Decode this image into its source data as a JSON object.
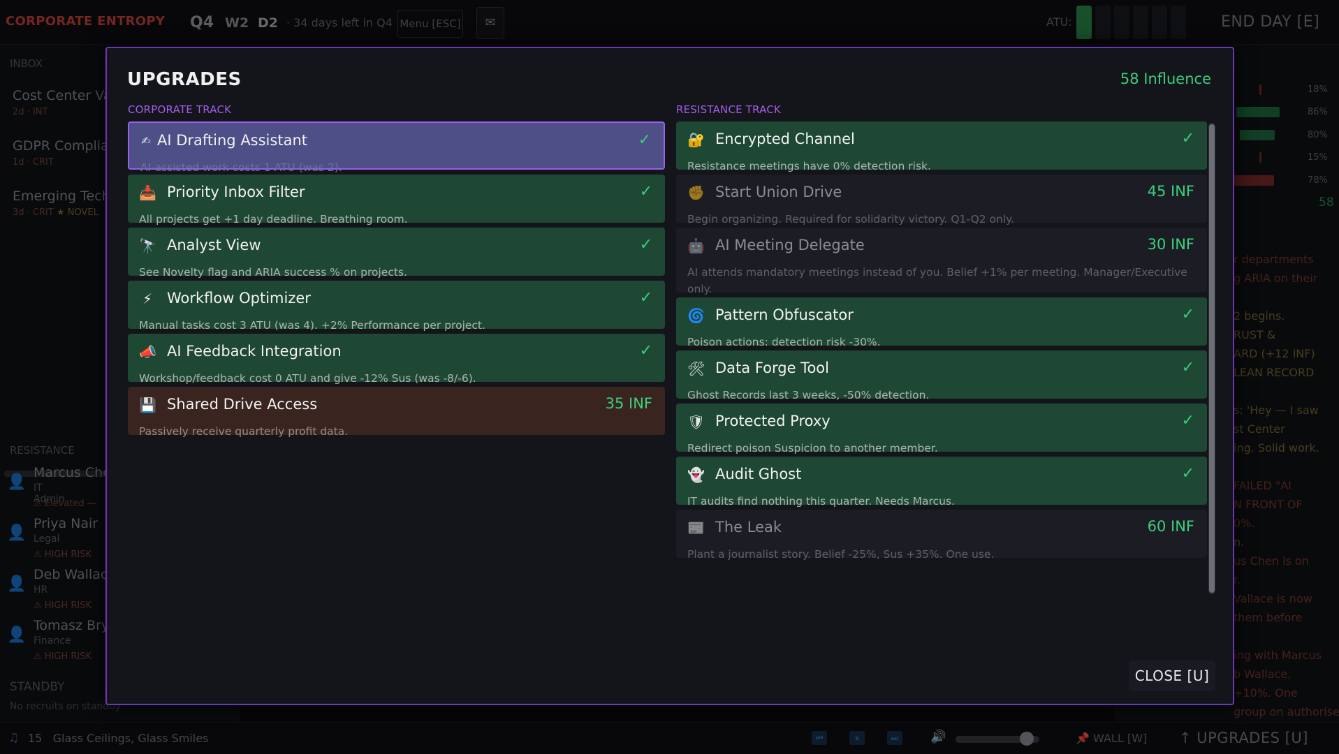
{
  "topbar": {
    "brand": "CORPORATE ENTROPY",
    "quarter": "Q4",
    "week": "W2",
    "day": "D2",
    "days_left": "· 34 days left in Q4",
    "menu_label": "Menu [ESC]",
    "atu_label": "ATU:",
    "atu_segments_filled": 1,
    "atu_segments_total": 6,
    "end_day_label": "END DAY [E]"
  },
  "left_panel": {
    "inbox_heading": "INBOX",
    "inbox_items": [
      {
        "title": "Cost Center Var",
        "meta": "2d · INT",
        "novel": ""
      },
      {
        "title": "GDPR Complian",
        "meta": "1d · CRIT",
        "novel": ""
      },
      {
        "title": "Emerging Tech",
        "meta": "3d · CRIT",
        "novel": "★ NOVEL"
      }
    ],
    "resistance_heading": "RESISTANCE",
    "members": [
      {
        "name": "Marcus Chen",
        "role": "IT Admin",
        "warning": "⚠ Elevated —"
      },
      {
        "name": "Priya Nair",
        "role": "Legal",
        "warning": "⚠ HIGH RISK"
      },
      {
        "name": "Deb Wallace",
        "role": "HR",
        "warning": "⚠ HIGH RISK"
      },
      {
        "name": "Tomasz Bryk",
        "role": "Finance",
        "warning": "⚠ HIGH RISK"
      }
    ],
    "standby_heading": "STANDBY",
    "standby_text": "No recruits on standby"
  },
  "right_panel": {
    "percentages": [
      "18%",
      "86%",
      "80%",
      "15%",
      "78%"
    ],
    "value": "58",
    "log_lines": [
      "r departments",
      "g ARIA on their",
      "",
      "2 begins.",
      "RUST &",
      "ARD (+12 INF)",
      "LEAN RECORD",
      "",
      "s: 'Hey — I saw",
      "st Center",
      "ing. Solid work.",
      "",
      "FAILED \"AI",
      "N FRONT OF",
      "0%.",
      "n.",
      "us Chen is on",
      "r.",
      "Vallace is now",
      "them before",
      "",
      "ing with Marcus",
      "b Wallace,",
      "+10%. One",
      "group on authorised"
    ]
  },
  "modal": {
    "title": "UPGRADES",
    "influence": "58 Influence",
    "corporate_label": "CORPORATE TRACK",
    "resistance_label": "RESISTANCE TRACK",
    "close_label": "CLOSE [U]",
    "corporate": [
      {
        "icon": "pen-icon",
        "glyph": "✍",
        "name": "AI Drafting Assistant",
        "desc": "AI-assisted work costs 1 ATU (was 2).",
        "status": "✓",
        "state": "selected"
      },
      {
        "icon": "inbox-tray-icon",
        "glyph": "📥",
        "name": "Priority Inbox Filter",
        "desc": "All projects get +1 day deadline. Breathing room.",
        "status": "✓",
        "state": "owned"
      },
      {
        "icon": "telescope-icon",
        "glyph": "🔭",
        "name": "Analyst View",
        "desc": "See Novelty flag and ARIA success % on projects.",
        "status": "✓",
        "state": "owned"
      },
      {
        "icon": "lightning-icon",
        "glyph": "⚡",
        "name": "Workflow Optimizer",
        "desc": "Manual tasks cost 3 ATU (was 4). +2% Performance per project.",
        "status": "✓",
        "state": "owned"
      },
      {
        "icon": "megaphone-icon",
        "glyph": "📣",
        "name": "AI Feedback Integration",
        "desc": "Workshop/feedback cost 0 ATU and give -12% Sus (was -8/-6).",
        "status": "✓",
        "state": "owned"
      },
      {
        "icon": "floppy-disk-icon",
        "glyph": "💾",
        "name": "Shared Drive Access",
        "desc": "Passively receive quarterly profit data.",
        "status": "35 INF",
        "state": "afford"
      }
    ],
    "resistance": [
      {
        "icon": "lock-icon",
        "glyph": "🔐",
        "name": "Encrypted Channel",
        "desc": "Resistance meetings have 0% detection risk.",
        "status": "✓",
        "state": "owned"
      },
      {
        "icon": "fist-icon",
        "glyph": "✊",
        "name": "Start Union Drive",
        "desc": "Begin organizing. Required for solidarity victory. Q1-Q2 only.",
        "status": "45 INF",
        "state": "locked"
      },
      {
        "icon": "robot-icon",
        "glyph": "🤖",
        "name": "AI Meeting Delegate",
        "desc": "AI attends mandatory meetings instead of you. Belief +1% per meeting. Manager/Executive only.",
        "status": "30 INF",
        "state": "locked"
      },
      {
        "icon": "cyclone-icon",
        "glyph": "🌀",
        "name": "Pattern Obfuscator",
        "desc": "Poison actions: detection risk -30%.",
        "status": "✓",
        "state": "owned"
      },
      {
        "icon": "tools-icon",
        "glyph": "🛠",
        "name": "Data Forge Tool",
        "desc": "Ghost Records last 3 weeks, -50% detection.",
        "status": "✓",
        "state": "owned"
      },
      {
        "icon": "shield-icon",
        "glyph": "🛡",
        "name": "Protected Proxy",
        "desc": "Redirect poison Suspicion to another member.",
        "status": "✓",
        "state": "owned"
      },
      {
        "icon": "ghost-icon",
        "glyph": "👻",
        "name": "Audit Ghost",
        "desc": "IT audits find nothing this quarter. Needs Marcus.",
        "status": "✓",
        "state": "owned"
      },
      {
        "icon": "newspaper-icon",
        "glyph": "📰",
        "name": "The Leak",
        "desc": "Plant a journalist story. Belief -25%, Sus +35%. One use.",
        "status": "60 INF",
        "state": "locked"
      }
    ]
  },
  "bottombar": {
    "track_number": "15",
    "track_title": "Glass Ceilings, Glass Smiles",
    "volume_level": 0.85,
    "wall_label": "WALL [W]",
    "upgrades_label": "↑ UPGRADES [U]"
  }
}
